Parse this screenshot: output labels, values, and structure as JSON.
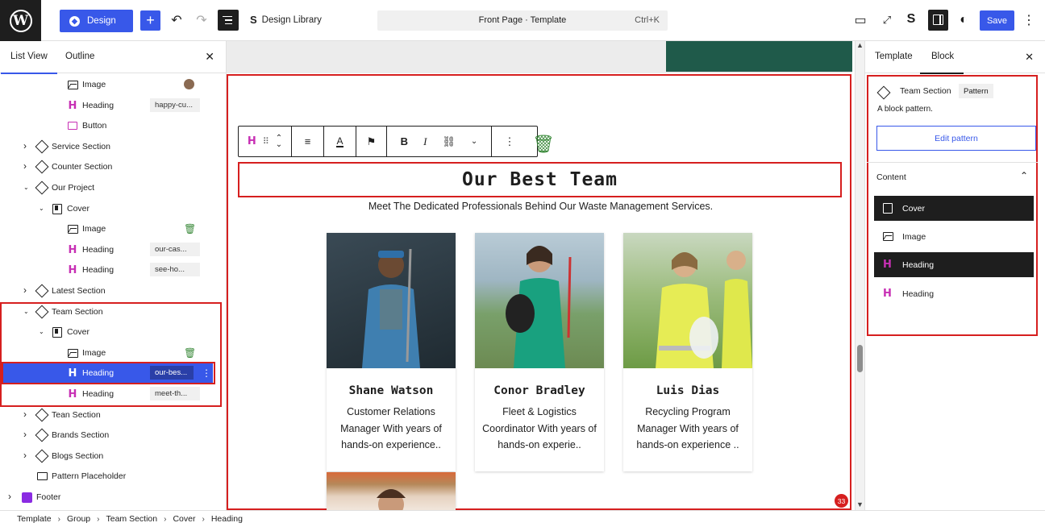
{
  "topbar": {
    "design_label": "Design",
    "design_library_label": "Design Library",
    "command_title": "Front Page · Template",
    "command_shortcut": "Ctrl+K",
    "save_label": "Save"
  },
  "list_view": {
    "tabs": [
      "List View",
      "Outline"
    ],
    "active_tab": "List View",
    "rows": [
      {
        "label": "Image",
        "icon": "image-icon",
        "depth": 3,
        "tag": null,
        "extra": "avatar-thumbnail"
      },
      {
        "label": "Heading",
        "icon": "heading-icon",
        "depth": 3,
        "tag": "happy-cu..."
      },
      {
        "label": "Button",
        "icon": "button-icon",
        "depth": 3,
        "tag": null
      },
      {
        "label": "Service Section",
        "icon": "pattern-icon",
        "depth": 1,
        "expand": "collapsed"
      },
      {
        "label": "Counter Section",
        "icon": "pattern-icon",
        "depth": 1,
        "expand": "collapsed"
      },
      {
        "label": "Our Project",
        "icon": "pattern-icon",
        "depth": 1,
        "expand": "expanded"
      },
      {
        "label": "Cover",
        "icon": "cover-icon",
        "depth": 2,
        "expand": "expanded"
      },
      {
        "label": "Image",
        "icon": "image-icon",
        "depth": 3,
        "extra": "trash-icon"
      },
      {
        "label": "Heading",
        "icon": "heading-icon",
        "depth": 3,
        "tag": "our-cas..."
      },
      {
        "label": "Heading",
        "icon": "heading-icon",
        "depth": 3,
        "tag": "see-ho..."
      },
      {
        "label": "Latest Section",
        "icon": "pattern-icon",
        "depth": 1,
        "expand": "collapsed"
      },
      {
        "label": "Team Section",
        "icon": "pattern-icon",
        "depth": 1,
        "expand": "expanded"
      },
      {
        "label": "Cover",
        "icon": "cover-icon",
        "depth": 2,
        "expand": "expanded"
      },
      {
        "label": "Image",
        "icon": "image-icon",
        "depth": 3,
        "extra": "trash-icon"
      },
      {
        "label": "Heading",
        "icon": "heading-icon",
        "depth": 3,
        "tag": "our-bes...",
        "selected": true
      },
      {
        "label": "Heading",
        "icon": "heading-icon",
        "depth": 3,
        "tag": "meet-th..."
      },
      {
        "label": "Tean Section",
        "icon": "pattern-icon",
        "depth": 1,
        "expand": "collapsed"
      },
      {
        "label": "Brands Section",
        "icon": "pattern-icon",
        "depth": 1,
        "expand": "collapsed"
      },
      {
        "label": "Blogs Section",
        "icon": "pattern-icon",
        "depth": 1,
        "expand": "collapsed"
      },
      {
        "label": "Pattern Placeholder",
        "icon": "placeholder-icon",
        "depth": 1
      },
      {
        "label": "Footer",
        "icon": "footer-icon",
        "depth": 0,
        "expand": "collapsed"
      }
    ]
  },
  "canvas": {
    "title": "Our Best Team",
    "subtitle": "Meet The Dedicated Professionals Behind Our Waste Management Services.",
    "cards": [
      {
        "name": "Shane Watson",
        "role": "Customer Relations Manager With years of hands-on experience..",
        "photo_color": "#2c3b45"
      },
      {
        "name": "Conor Bradley",
        "role": "Fleet & Logistics Coordinator With years of hands-on experie..",
        "photo_color": "#4f8f6e"
      },
      {
        "name": "Luis Dias",
        "role": "Recycling Program Manager With years of hands-on experience ..",
        "photo_color": "#8fb06b"
      }
    ],
    "notification_count": "33"
  },
  "inspector": {
    "tabs": [
      "Template",
      "Block"
    ],
    "active_tab": "Block",
    "block_name": "Team Section",
    "block_badge": "Pattern",
    "block_description": "A block pattern.",
    "edit_pattern_label": "Edit pattern",
    "content_label": "Content",
    "content_items": [
      {
        "label": "Cover",
        "icon": "cover-icon",
        "active": true
      },
      {
        "label": "Image",
        "icon": "image-icon",
        "active": false
      },
      {
        "label": "Heading",
        "icon": "heading-icon",
        "active": true
      },
      {
        "label": "Heading",
        "icon": "heading-icon",
        "active": false
      }
    ]
  },
  "breadcrumb": [
    "Template",
    "Group",
    "Team Section",
    "Cover",
    "Heading"
  ],
  "colors": {
    "accent": "#3858e9",
    "highlight": "#d61f1f",
    "heading_icon": "#c72fb4"
  }
}
